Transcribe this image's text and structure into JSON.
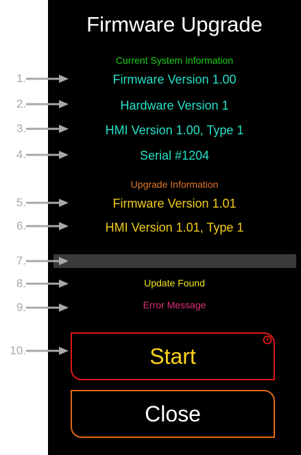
{
  "title": "Firmware Upgrade",
  "current": {
    "heading": "Current System Information",
    "firmware": "Firmware Version 1.00",
    "hardware": "Hardware Version 1",
    "hmi": "HMI Version 1.00, Type 1",
    "serial": "Serial #1204"
  },
  "upgrade": {
    "heading": "Upgrade Information",
    "firmware": "Firmware Version 1.01",
    "hmi": "HMI Version 1.01, Type 1"
  },
  "status": {
    "update_found": "Update Found",
    "error_message": "Error Message"
  },
  "buttons": {
    "start": "Start",
    "close": "Close"
  },
  "callouts": [
    "1.",
    "2.",
    "3.",
    "4.",
    "5.",
    "6.",
    "7.",
    "8.",
    "9.",
    "10."
  ],
  "colors": {
    "background": "#000000",
    "current_heading": "#19d219",
    "current_text": "#26e0c8",
    "upgrade_heading": "#e0782a",
    "upgrade_text": "#f2cb1a",
    "update_found": "#f2e61a",
    "error": "#e0307a",
    "start_border": "#e01818",
    "close_border": "#e06a18",
    "callout": "#a8a8a8"
  },
  "icons": {
    "callout_arrow": "right-arrow-icon",
    "start_timer": "clock-icon"
  }
}
